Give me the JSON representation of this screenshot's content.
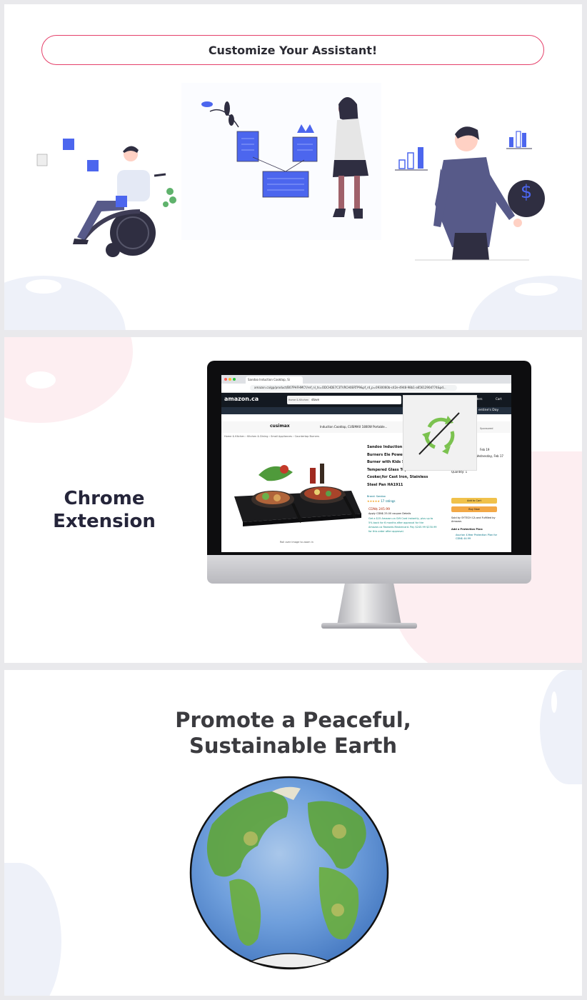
{
  "panel1": {
    "cta_label": "Customize Your Assistant!"
  },
  "panel2": {
    "title_line1": "Chrome",
    "title_line2": "Extension",
    "browser": {
      "tab_title": "Sandoo Induction Cooktop, Si",
      "url": "amazon.ca/gp/product/B07PHFHMCY/ref_nl_ts=ODCHDE7C3TVRCH0ERTP9&pf_rd_p=0930060b-c42e-4948-98b1-a6561290d774&pd...",
      "logo": "amazon.ca",
      "search_category": "Home & Kitchen",
      "search_query": "stove",
      "nav_items": [
        "All",
        "Best Sellers",
        "Gift Ideas",
        "Prime",
        "Sarah's Store",
        "Buy Again",
        "Customer Service",
        "Deals Store",
        "New Releases"
      ],
      "nav_right": "entine's Day",
      "sub_items": [
        "Home",
        "Best Sellers",
        "Kitchen & Dining",
        "Arts, Crafts & Sewing",
        "Furniture",
        "Vacuums & Floor Care",
        "Bedding",
        "Storage & Organizatio"
      ],
      "banner_brand": "cusimax",
      "banner_text": "Induction Cooktop, CUSIMAX 1800W Portable...",
      "breadcrumbs": "Home & Kitchen › Kitchen & Dining › Small Appliances › Countertop Burners",
      "product_title": "Sandoo Induction C Double Burners Ele Power/Temp Levels Burner with Kids Safety Lock, Tempered Glass Top Induction Cooker,for Cast Iron, Stainless Steel Pan HA1911",
      "brand": "Brand: Sandoo",
      "ratings": "17 ratings",
      "price": "CDN$ 245.99",
      "coupon": "Apply CDN$ 25.00 coupon Details",
      "deal": "Get a $15 Amazon.ca Gift Card instantly, plus up to 5% back for 6 months after approval for the Amazon.ca Rewards Mastercard. Pay $245.99 $230.99 for this order after approval.",
      "delivery": "Fastest delivery: Wednesday, Feb 17",
      "date_top": "Feb 19",
      "stock": "In Stock.",
      "quantity": "Quantity: 1",
      "add_to_cart": "Add to Cart",
      "buy_now": "Buy Now",
      "sold_by": "Sold by SYTECH CA and Fulfilled by Amazon.",
      "protection": "Add a Protection Plan:",
      "protection_item": "Asurion 4-Year Protection Plan for CDN$ 44.99",
      "roll_over": "Roll over image to zoom in",
      "sponsored": "Sponsored",
      "cart": "Cart",
      "orders": "Orders"
    }
  },
  "panel3": {
    "title_line1": "Promote a Peaceful,",
    "title_line2": "Sustainable Earth"
  },
  "colors": {
    "accent_pink": "#e5406a",
    "illustration_blue": "#4c66ee",
    "extension_green": "#7bc24f",
    "dark_text": "#25253a"
  }
}
